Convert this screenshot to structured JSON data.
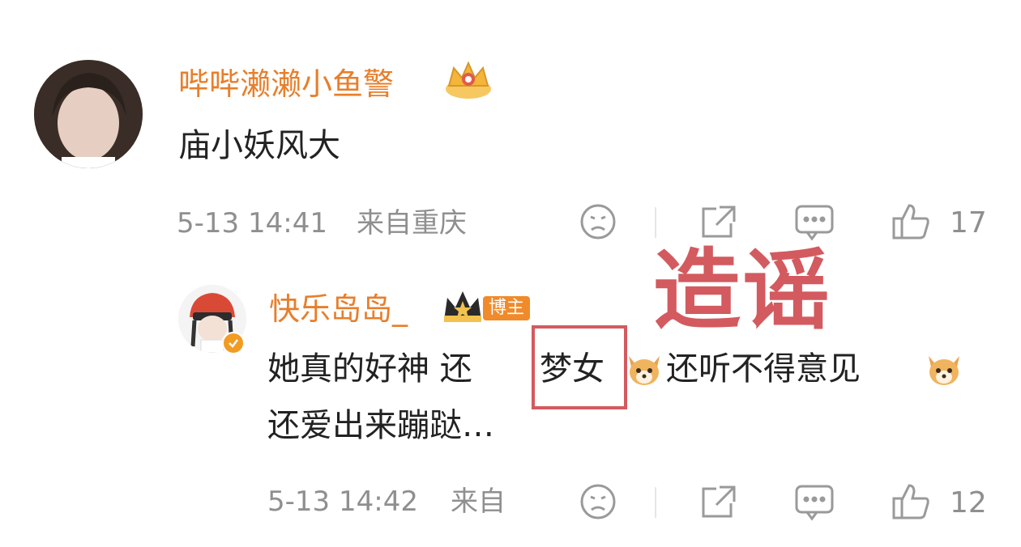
{
  "comments": [
    {
      "username": "哔哔濑濑小鱼警",
      "text": "庙小妖风大",
      "time": "5-13 14:41",
      "location": "来自重庆",
      "likes": "17"
    },
    {
      "username": "快乐岛岛_",
      "badge": "博主",
      "text_line1": "她真的好神 还",
      "highlight": "梦女",
      "text_line1_mid": "还听不得意见",
      "text_line2": "还爱出来蹦跶…",
      "time": "5-13 14:42",
      "location": "来自",
      "likes": "12"
    }
  ],
  "annotation": {
    "text": "造谣",
    "color": "#d35a5f"
  },
  "colors": {
    "username": "#e87e2a",
    "meta": "#8f8f8f",
    "text": "#222222"
  },
  "icons": [
    "crown-icon",
    "dislike-face-icon",
    "share-icon",
    "comment-icon",
    "like-icon",
    "dog-emoji-icon",
    "verified-icon"
  ]
}
